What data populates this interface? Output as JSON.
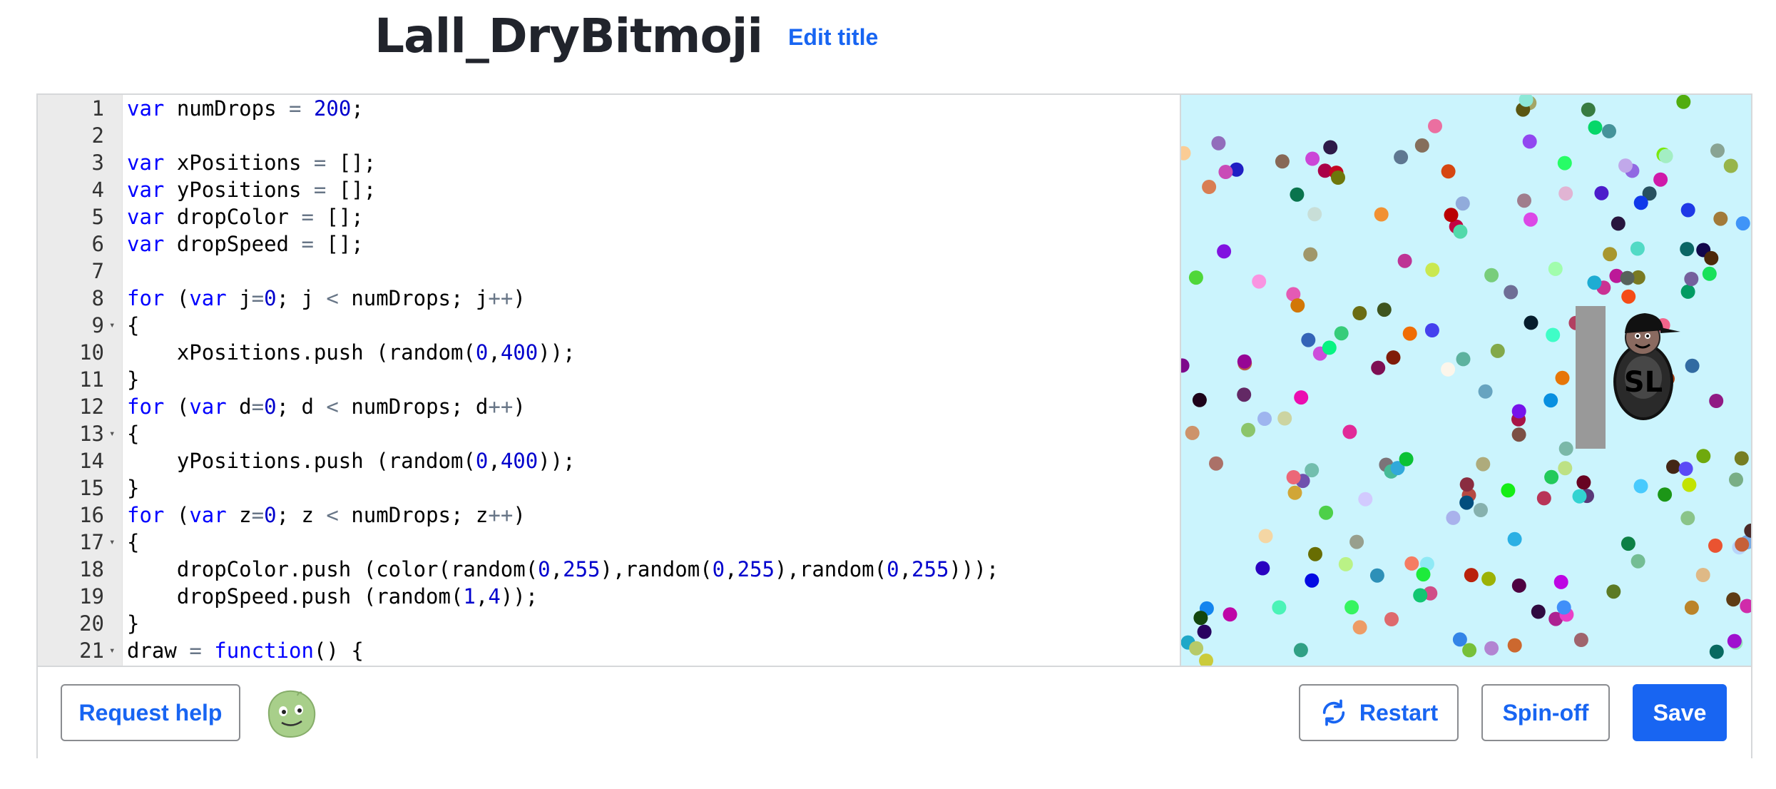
{
  "header": {
    "title": "Lall_DryBitmoji",
    "edit_title_label": "Edit title"
  },
  "editor": {
    "lines": [
      {
        "n": "1",
        "fold": false,
        "tokens": [
          {
            "t": "var",
            "c": "kw"
          },
          {
            "t": " numDrops "
          },
          {
            "t": "=",
            "c": "op"
          },
          {
            "t": " "
          },
          {
            "t": "200",
            "c": "num"
          },
          {
            "t": ";"
          }
        ]
      },
      {
        "n": "2",
        "fold": false,
        "tokens": []
      },
      {
        "n": "3",
        "fold": false,
        "tokens": [
          {
            "t": "var",
            "c": "kw"
          },
          {
            "t": " xPositions "
          },
          {
            "t": "=",
            "c": "op"
          },
          {
            "t": " [];"
          }
        ]
      },
      {
        "n": "4",
        "fold": false,
        "tokens": [
          {
            "t": "var",
            "c": "kw"
          },
          {
            "t": " yPositions "
          },
          {
            "t": "=",
            "c": "op"
          },
          {
            "t": " [];"
          }
        ]
      },
      {
        "n": "5",
        "fold": false,
        "tokens": [
          {
            "t": "var",
            "c": "kw"
          },
          {
            "t": " dropColor "
          },
          {
            "t": "=",
            "c": "op"
          },
          {
            "t": " [];"
          }
        ]
      },
      {
        "n": "6",
        "fold": false,
        "tokens": [
          {
            "t": "var",
            "c": "kw"
          },
          {
            "t": " dropSpeed "
          },
          {
            "t": "=",
            "c": "op"
          },
          {
            "t": " [];"
          }
        ]
      },
      {
        "n": "7",
        "fold": false,
        "tokens": []
      },
      {
        "n": "8",
        "fold": false,
        "tokens": [
          {
            "t": "for",
            "c": "kw"
          },
          {
            "t": " ("
          },
          {
            "t": "var",
            "c": "kw"
          },
          {
            "t": " j"
          },
          {
            "t": "=",
            "c": "op"
          },
          {
            "t": "0",
            "c": "num"
          },
          {
            "t": "; j "
          },
          {
            "t": "<",
            "c": "op"
          },
          {
            "t": " numDrops; j"
          },
          {
            "t": "++",
            "c": "op"
          },
          {
            "t": ")"
          }
        ]
      },
      {
        "n": "9",
        "fold": true,
        "tokens": [
          {
            "t": "{"
          }
        ]
      },
      {
        "n": "10",
        "fold": false,
        "tokens": [
          {
            "t": "    xPositions.push (random("
          },
          {
            "t": "0",
            "c": "num"
          },
          {
            "t": ","
          },
          {
            "t": "400",
            "c": "num"
          },
          {
            "t": "));"
          }
        ]
      },
      {
        "n": "11",
        "fold": false,
        "tokens": [
          {
            "t": "}"
          }
        ]
      },
      {
        "n": "12",
        "fold": false,
        "tokens": [
          {
            "t": "for",
            "c": "kw"
          },
          {
            "t": " ("
          },
          {
            "t": "var",
            "c": "kw"
          },
          {
            "t": " d"
          },
          {
            "t": "=",
            "c": "op"
          },
          {
            "t": "0",
            "c": "num"
          },
          {
            "t": "; d "
          },
          {
            "t": "<",
            "c": "op"
          },
          {
            "t": " numDrops; d"
          },
          {
            "t": "++",
            "c": "op"
          },
          {
            "t": ")"
          }
        ]
      },
      {
        "n": "13",
        "fold": true,
        "tokens": [
          {
            "t": "{"
          }
        ]
      },
      {
        "n": "14",
        "fold": false,
        "tokens": [
          {
            "t": "    yPositions.push (random("
          },
          {
            "t": "0",
            "c": "num"
          },
          {
            "t": ","
          },
          {
            "t": "400",
            "c": "num"
          },
          {
            "t": "));"
          }
        ]
      },
      {
        "n": "15",
        "fold": false,
        "tokens": [
          {
            "t": "}"
          }
        ]
      },
      {
        "n": "16",
        "fold": false,
        "tokens": [
          {
            "t": "for",
            "c": "kw"
          },
          {
            "t": " ("
          },
          {
            "t": "var",
            "c": "kw"
          },
          {
            "t": " z"
          },
          {
            "t": "=",
            "c": "op"
          },
          {
            "t": "0",
            "c": "num"
          },
          {
            "t": "; z "
          },
          {
            "t": "<",
            "c": "op"
          },
          {
            "t": " numDrops; z"
          },
          {
            "t": "++",
            "c": "op"
          },
          {
            "t": ")"
          }
        ]
      },
      {
        "n": "17",
        "fold": true,
        "tokens": [
          {
            "t": "{"
          }
        ]
      },
      {
        "n": "18",
        "fold": false,
        "tokens": [
          {
            "t": "    dropColor.push (color(random("
          },
          {
            "t": "0",
            "c": "num"
          },
          {
            "t": ","
          },
          {
            "t": "255",
            "c": "num"
          },
          {
            "t": "),random("
          },
          {
            "t": "0",
            "c": "num"
          },
          {
            "t": ","
          },
          {
            "t": "255",
            "c": "num"
          },
          {
            "t": "),random("
          },
          {
            "t": "0",
            "c": "num"
          },
          {
            "t": ","
          },
          {
            "t": "255",
            "c": "num"
          },
          {
            "t": ")));"
          }
        ]
      },
      {
        "n": "19",
        "fold": false,
        "tokens": [
          {
            "t": "    dropSpeed.push (random("
          },
          {
            "t": "1",
            "c": "num"
          },
          {
            "t": ","
          },
          {
            "t": "4",
            "c": "num"
          },
          {
            "t": "));"
          }
        ]
      },
      {
        "n": "20",
        "fold": false,
        "tokens": [
          {
            "t": "}"
          }
        ]
      },
      {
        "n": "21",
        "fold": true,
        "tokens": [
          {
            "t": "draw "
          },
          {
            "t": "=",
            "c": "op"
          },
          {
            "t": " "
          },
          {
            "t": "function",
            "c": "kw"
          },
          {
            "t": "() {"
          }
        ]
      }
    ]
  },
  "canvas": {
    "background": "#cbf4fd",
    "bitmoji_letters": "SL"
  },
  "footer": {
    "request_help_label": "Request help",
    "restart_label": "Restart",
    "spinoff_label": "Spin-off",
    "save_label": "Save"
  },
  "colors": {
    "accent": "#1865f2",
    "title": "#21242c"
  }
}
